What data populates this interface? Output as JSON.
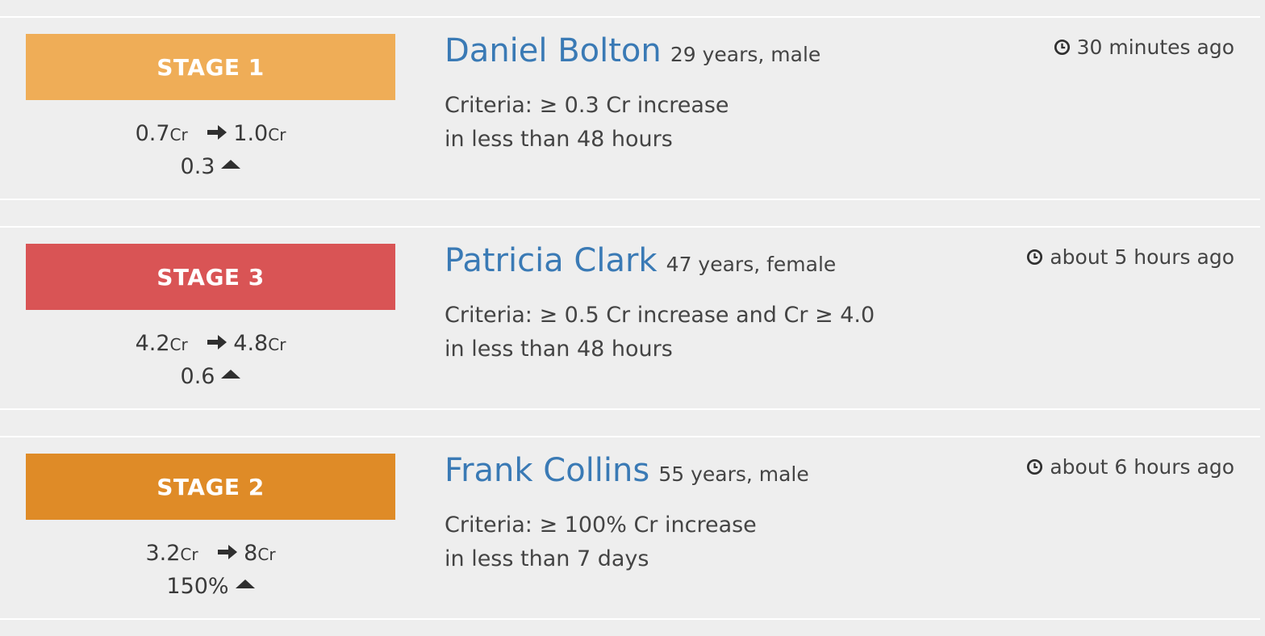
{
  "alerts": [
    {
      "stage_label": "STAGE 1",
      "stage_color": "#efad57",
      "cr_from": "0.7",
      "cr_to": "1.0",
      "cr_unit": "Cr",
      "change": "0.3",
      "name": "Daniel Bolton",
      "demographics": "29 years, male",
      "criteria_line1": "Criteria: ≥ 0.3 Cr increase",
      "criteria_line2": "in less than 48 hours",
      "time": "30 minutes ago"
    },
    {
      "stage_label": "STAGE 3",
      "stage_color": "#d95455",
      "cr_from": "4.2",
      "cr_to": "4.8",
      "cr_unit": "Cr",
      "change": "0.6",
      "name": "Patricia Clark",
      "demographics": "47 years, female",
      "criteria_line1": "Criteria: ≥ 0.5 Cr increase and Cr ≥ 4.0",
      "criteria_line2": "in less than 48 hours",
      "time": "about 5 hours ago"
    },
    {
      "stage_label": "STAGE 2",
      "stage_color": "#df8b27",
      "cr_from": "3.2",
      "cr_to": "8",
      "cr_unit": "Cr",
      "change": "150%",
      "name": "Frank Collins",
      "demographics": "55 years, male",
      "criteria_line1": "Criteria: ≥ 100% Cr increase",
      "criteria_line2": "in less than 7 days",
      "time": "about 6 hours ago"
    }
  ],
  "icons": {
    "arrow": "arrow-right-icon",
    "increase": "caret-up-icon",
    "time": "clock-icon"
  }
}
